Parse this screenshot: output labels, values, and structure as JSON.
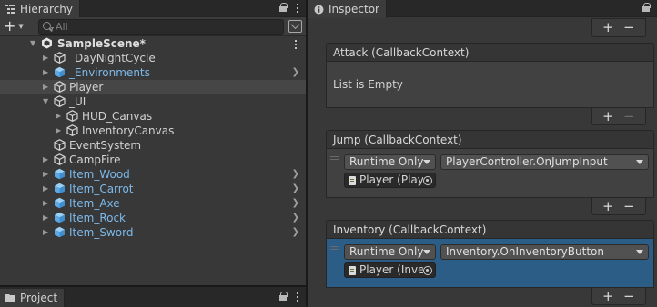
{
  "hierarchy": {
    "tab_label": "Hierarchy",
    "search_placeholder": "All",
    "scene_name": "SampleScene*",
    "items": [
      {
        "label": "_DayNightCycle",
        "prefab": false
      },
      {
        "label": "_Environments",
        "prefab": true
      },
      {
        "label": "Player",
        "prefab": false
      },
      {
        "label": "_UI",
        "prefab": false
      },
      {
        "label": "HUD_Canvas",
        "prefab": false
      },
      {
        "label": "InventoryCanvas",
        "prefab": false
      },
      {
        "label": "EventSystem",
        "prefab": false
      },
      {
        "label": "CampFire",
        "prefab": false
      },
      {
        "label": "Item_Wood",
        "prefab": true
      },
      {
        "label": "Item_Carrot",
        "prefab": true
      },
      {
        "label": "Item_Axe",
        "prefab": true
      },
      {
        "label": "Item_Rock",
        "prefab": true
      },
      {
        "label": "Item_Sword",
        "prefab": true
      }
    ]
  },
  "project": {
    "tab_label": "Project"
  },
  "inspector": {
    "tab_label": "Inspector",
    "plus": "+",
    "minus": "−",
    "events": [
      {
        "header": "Attack (CallbackContext)",
        "empty_text": "List is Empty"
      },
      {
        "header": "Jump (CallbackContext)",
        "runtime": "Runtime Only",
        "function": "PlayerController.OnJumpInput",
        "object": "Player (Player"
      },
      {
        "header": "Inventory (CallbackContext)",
        "runtime": "Runtime Only",
        "function": "Inventory.OnInventoryButton",
        "object": "Player (Inventory"
      }
    ]
  },
  "colors": {
    "prefab_text": "#7cb9ea",
    "selection_blue": "#2c5d87",
    "selected_row": "#464646"
  }
}
